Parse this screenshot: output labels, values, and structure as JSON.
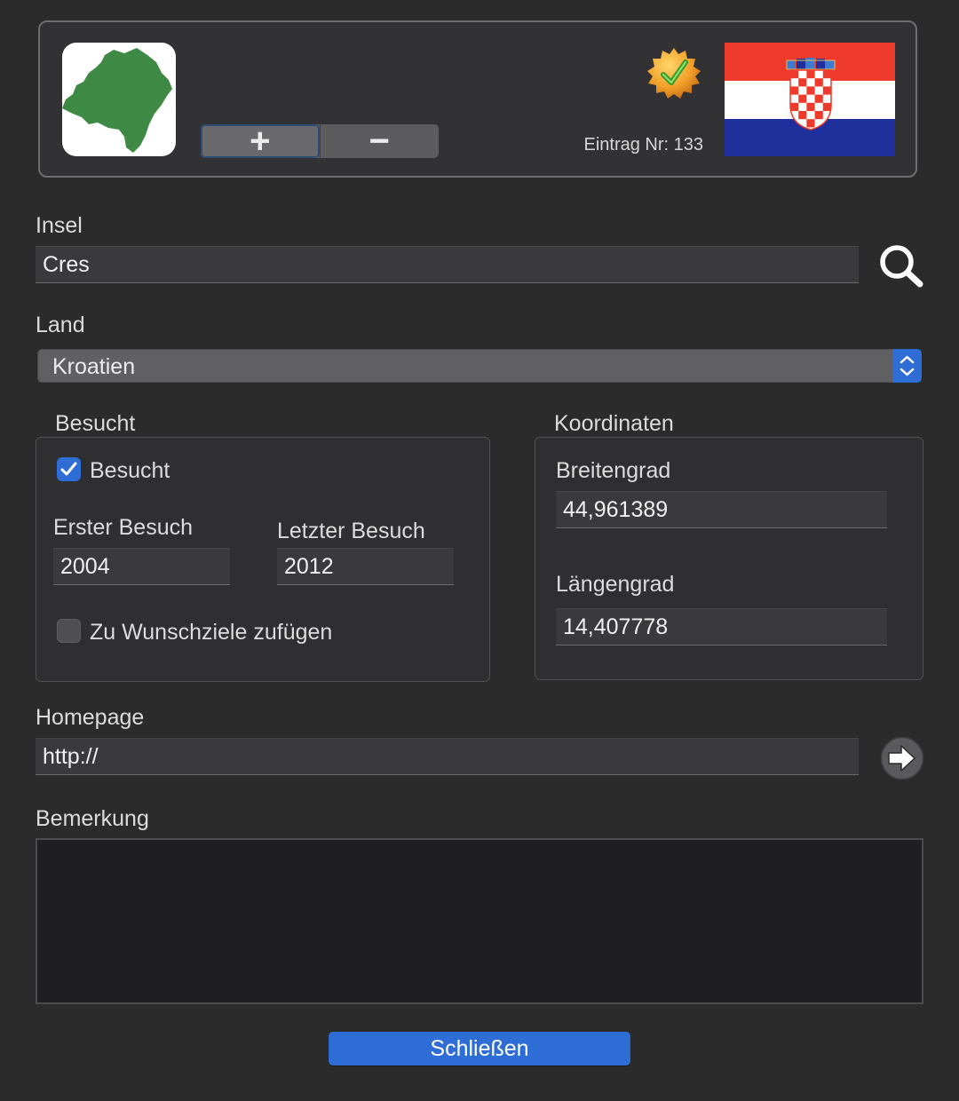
{
  "header": {
    "entry_label": "Eintrag Nr: 133",
    "add_button": "+",
    "remove_button": "−",
    "verified_icon": "gold-seal-checkmark-icon",
    "flag_icon": "croatia-flag",
    "island_thumbnail_icon": "island-map-silhouette"
  },
  "insel": {
    "label": "Insel",
    "value": "Cres",
    "search_icon": "search-icon"
  },
  "land": {
    "label": "Land",
    "value": "Kroatien"
  },
  "besucht": {
    "group_title": "Besucht",
    "checkbox_label": "Besucht",
    "checked": true,
    "erster_label": "Erster Besuch",
    "erster_value": "2004",
    "letzter_label": "Letzter Besuch",
    "letzter_value": "2012",
    "wunsch_label": "Zu Wunschziele zufügen",
    "wunsch_checked": false
  },
  "koordinaten": {
    "group_title": "Koordinaten",
    "breite_label": "Breitengrad",
    "breite_value": "44,961389",
    "laenge_label": "Längengrad",
    "laenge_value": "14,407778"
  },
  "homepage": {
    "label": "Homepage",
    "value": "http://",
    "go_icon": "arrow-right-icon"
  },
  "bemerkung": {
    "label": "Bemerkung",
    "value": ""
  },
  "footer": {
    "close_button": "Schließen"
  },
  "colors": {
    "background": "#2b2b2c",
    "accent": "#2f6dd6",
    "island_green": "#3e8a45",
    "flag_red": "#ee3a2a",
    "flag_blue": "#1f2f9c"
  }
}
